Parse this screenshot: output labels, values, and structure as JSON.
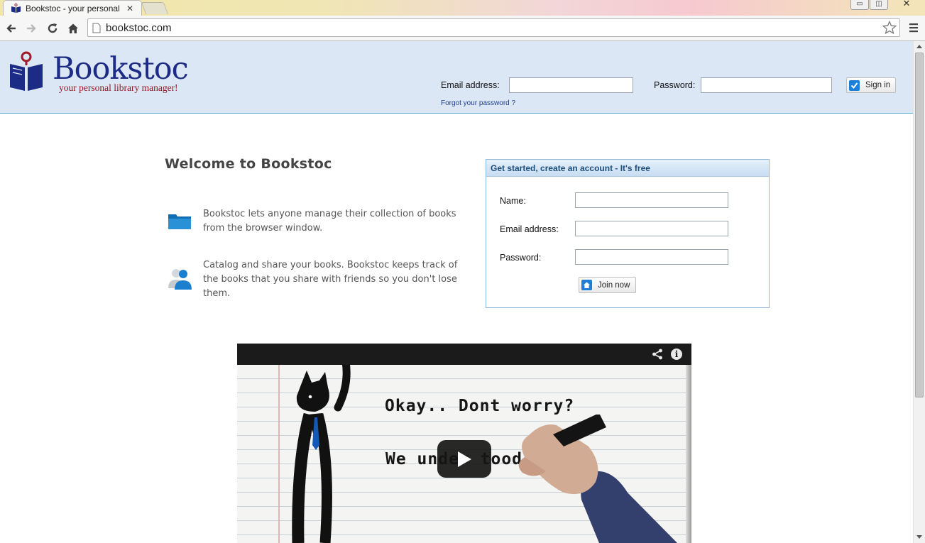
{
  "browser": {
    "tab_title": "Bookstoc - your personal l",
    "url": "bookstoc.com"
  },
  "header": {
    "logo_name": "Bookstoc",
    "logo_tagline": "your personal library manager!",
    "email_label": "Email address:",
    "password_label": "Password:",
    "signin_label": "Sign in",
    "forgot_link": "Forgot your password ?"
  },
  "welcome": {
    "title": "Welcome to Bookstoc",
    "features": [
      {
        "text": "Bookstoc lets anyone manage their collection of books from the browser window.",
        "icon": "folder-icon"
      },
      {
        "text": "Catalog and share your books. Bookstoc keeps track of the books that you share with friends so you don't lose them.",
        "icon": "user-icon"
      }
    ]
  },
  "signup": {
    "heading": "Get started, create an account - It's free",
    "name_label": "Name:",
    "email_label": "Email address:",
    "password_label": "Password:",
    "join_label": "Join now"
  },
  "video": {
    "line1": "Okay.. Dont worry?",
    "line2": "We under  tood w"
  },
  "colors": {
    "header_bg": "#dce7f5",
    "logo_blue": "#1c2b86",
    "tagline_red": "#8e1a24",
    "link_blue": "#1f3f8c",
    "accent_blue": "#1e7fd6"
  }
}
